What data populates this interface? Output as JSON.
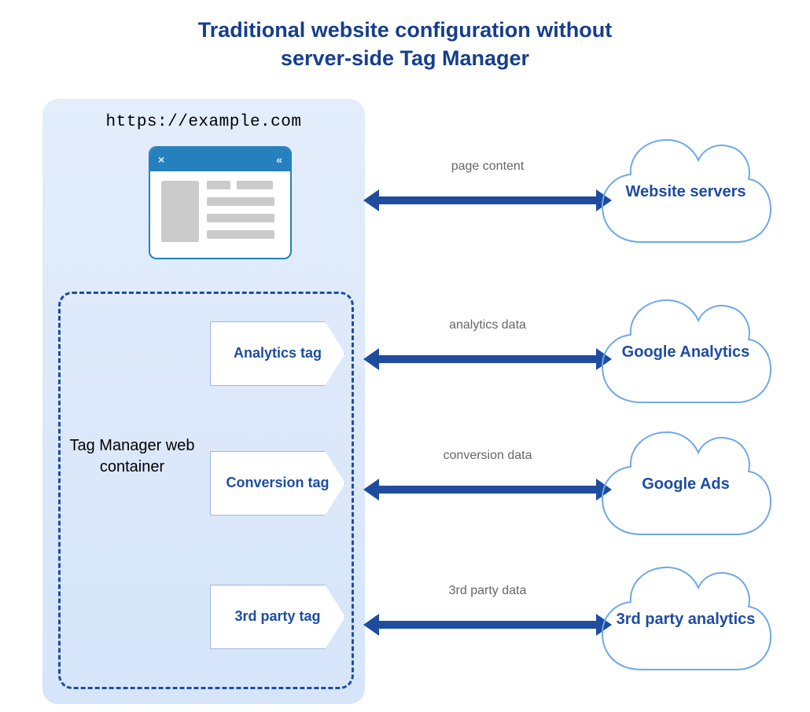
{
  "title_line1": "Traditional website configuration without",
  "title_line2": "server-side Tag Manager",
  "browser_url": "https://example.com",
  "browser_close_glyph": "×",
  "browser_collapse_glyph": "«",
  "container_label": "Tag Manager web container",
  "tags": [
    {
      "label": "Analytics tag"
    },
    {
      "label": "Conversion tag"
    },
    {
      "label": "3rd party tag"
    }
  ],
  "arrows": [
    {
      "label": "page content"
    },
    {
      "label": "analytics data"
    },
    {
      "label": "conversion data"
    },
    {
      "label": "3rd party data"
    }
  ],
  "clouds": [
    {
      "label": "Website servers"
    },
    {
      "label": "Google Analytics"
    },
    {
      "label": "Google Ads"
    },
    {
      "label": "3rd party analytics"
    }
  ],
  "colors": {
    "accent": "#1E4DA0",
    "panel_bg": "#E3EDFB",
    "cloud_fill_light": "#D0E5FB",
    "cloud_fill_dark": "#78B6F2",
    "browser_bar": "#2680BE"
  }
}
